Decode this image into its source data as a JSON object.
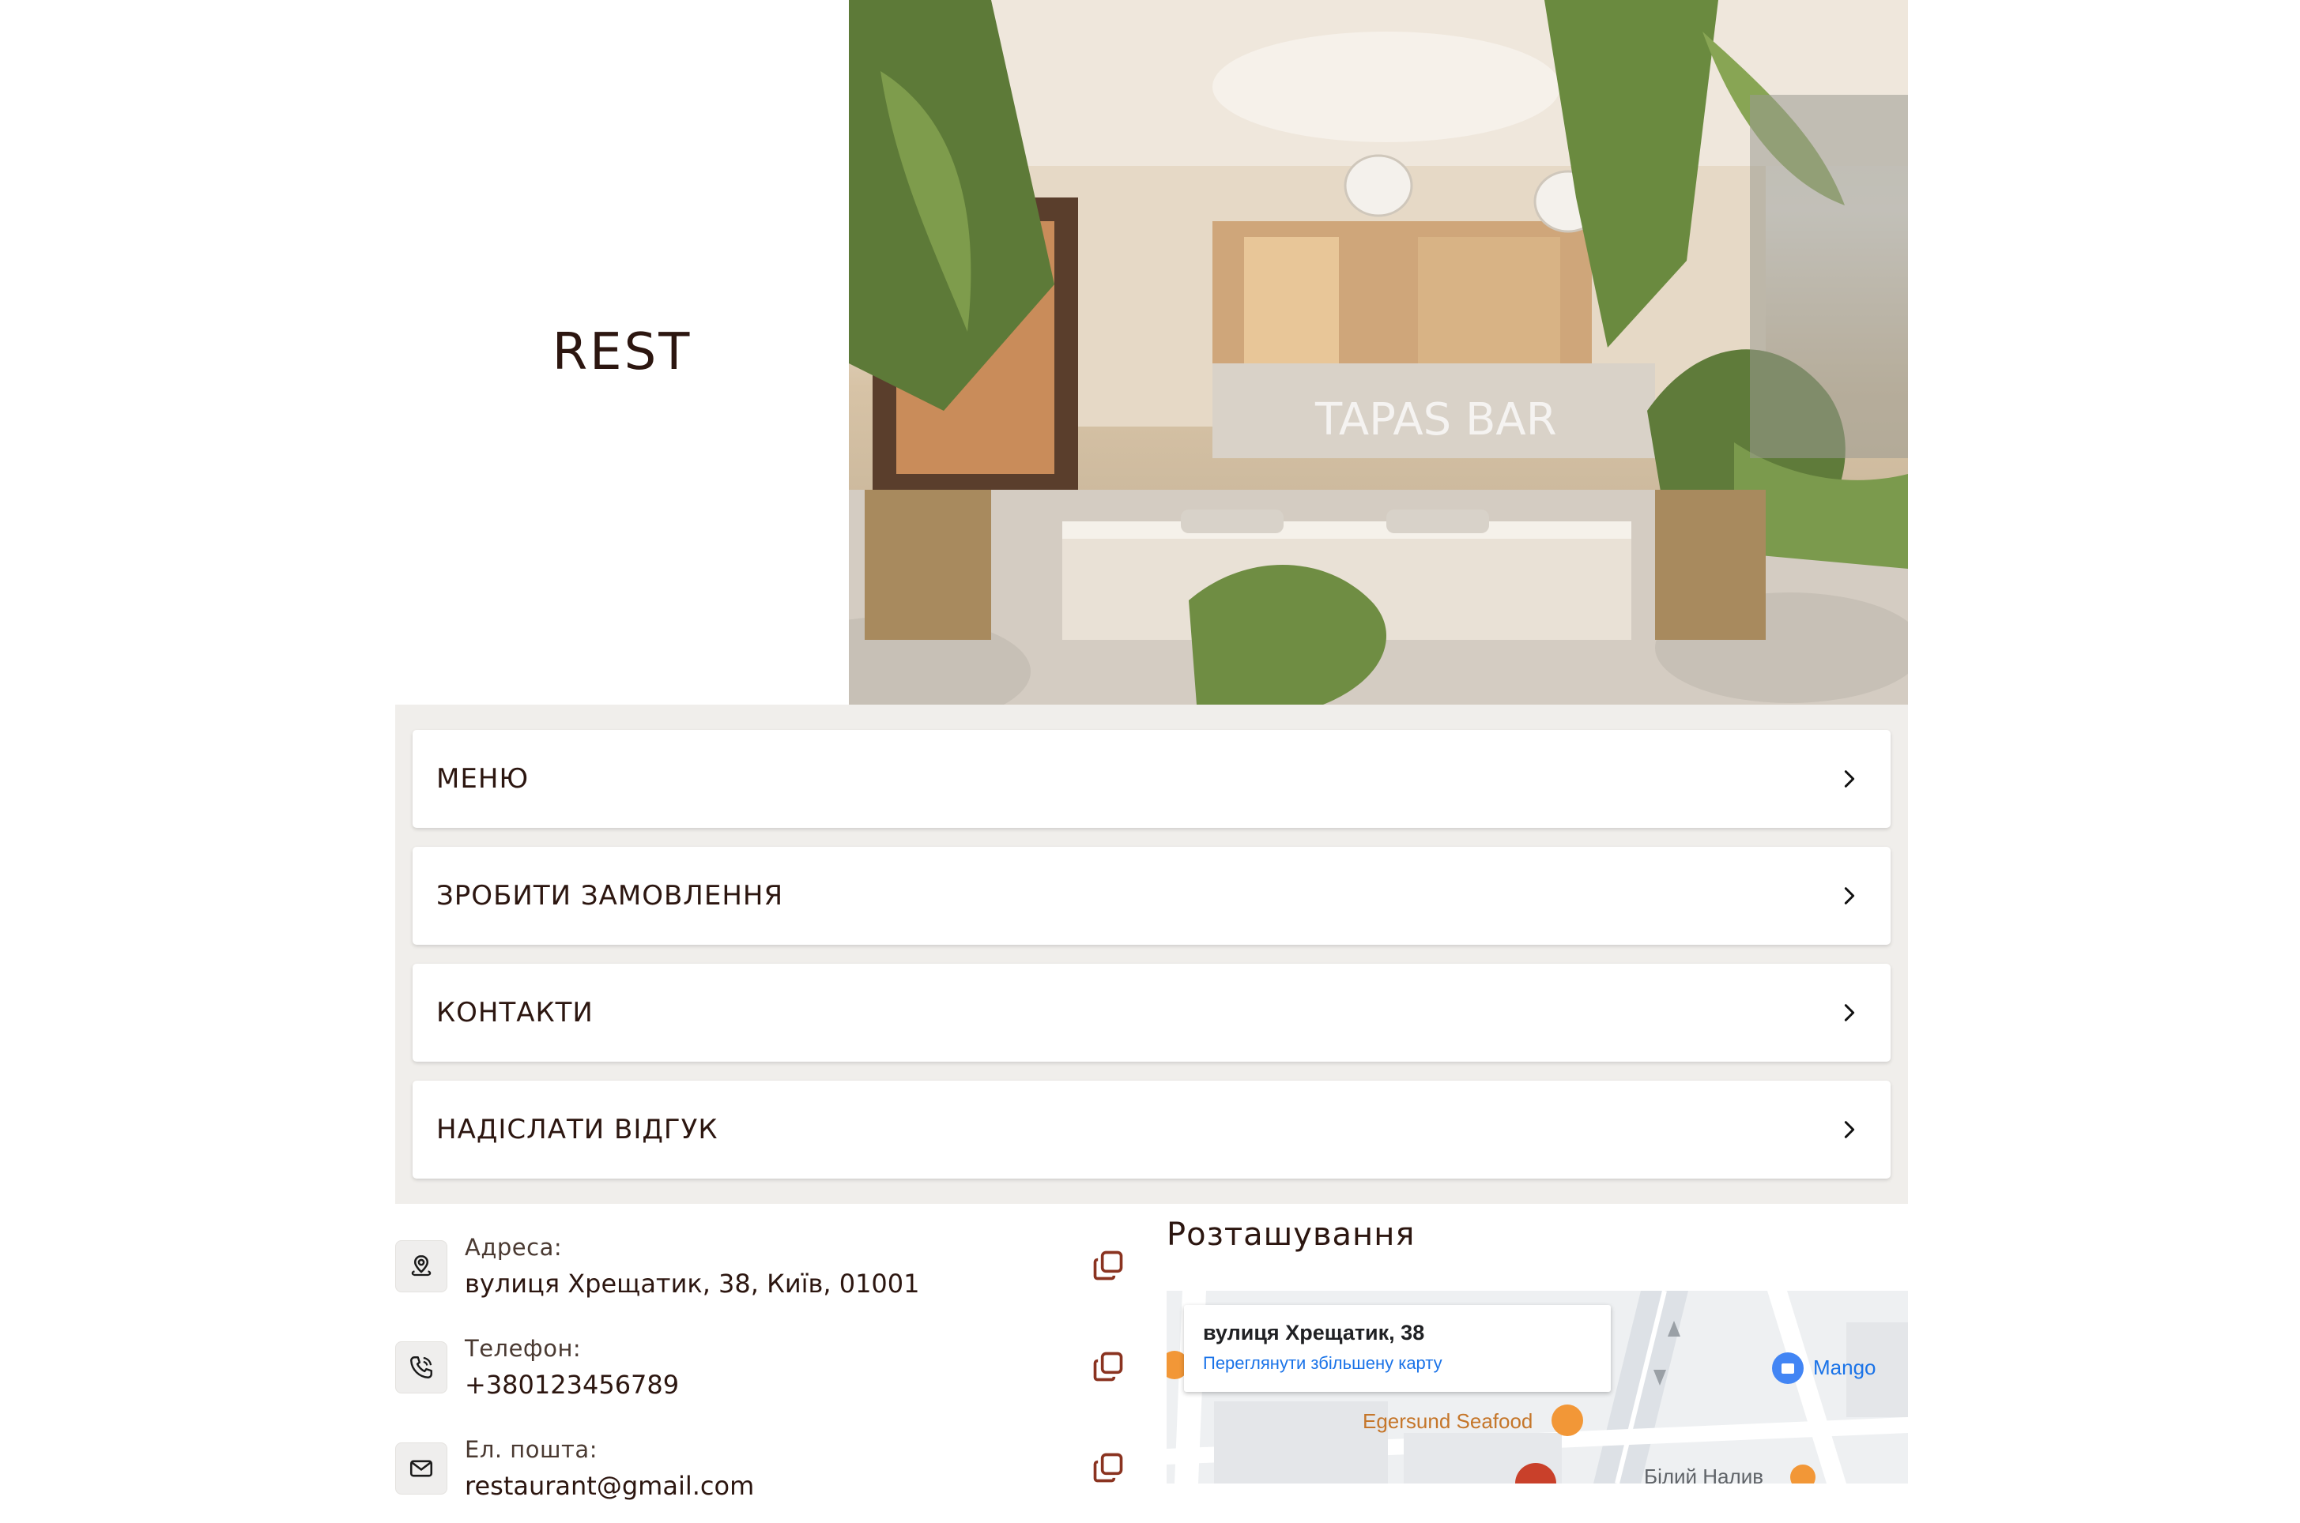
{
  "brand": {
    "title": "REST"
  },
  "hero": {
    "sign_text": "TAPAS BAR"
  },
  "menu": {
    "items": [
      {
        "label": "МЕНЮ"
      },
      {
        "label": "ЗРОБИТИ ЗАМОВЛЕННЯ"
      },
      {
        "label": "КОНТАКТИ"
      },
      {
        "label": "НАДІСЛАТИ ВІДГУК"
      }
    ]
  },
  "contacts": {
    "address": {
      "label": "Адреса:",
      "value": "вулиця Хрещатик, 38, Київ, 01001",
      "icon": "location-pin-icon"
    },
    "phone": {
      "label": "Телефон:",
      "value": "+380123456789",
      "icon": "phone-icon"
    },
    "email": {
      "label": "Ел. пошта:",
      "value": "restaurant@gmail.com",
      "icon": "mail-icon"
    }
  },
  "location": {
    "title": "Розташування",
    "map": {
      "card_title": "вулиця Хрещатик, 38",
      "card_link": "Переглянути збільшену карту",
      "poi_mango": "Mango",
      "poi_egersund": "Egersund Seafood",
      "poi_bilyi": "Білий Налив"
    }
  },
  "colors": {
    "text": "#2c1610",
    "copy_icon": "#8a3320",
    "panel_bg": "#f0eeeb",
    "map_link": "#1a73e8"
  }
}
